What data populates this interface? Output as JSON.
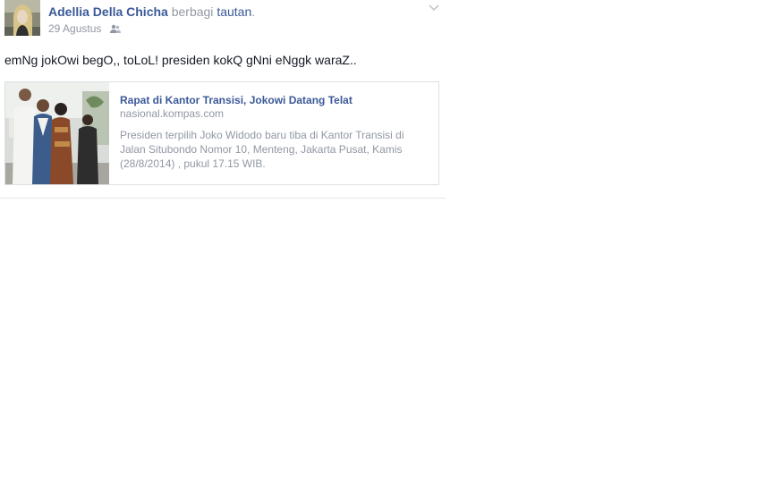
{
  "post": {
    "author": "Adellia Della Chicha",
    "verb": "berbagi",
    "object_link": "tautan",
    "punctuation": ".",
    "date": "29 Agustus",
    "audience_icon": "friends-icon",
    "message": "emNg jokOwi begO,, toLoL! presiden kokQ gNni eNggk waraZ..",
    "attachment": {
      "title": "Rapat di Kantor Transisi, Jokowi Datang Telat",
      "domain": "nasional.kompas.com",
      "description": "Presiden terpilih Joko Widodo baru tiba di Kantor Transisi di Jalan Situbondo Nomor 10, Menteng, Jakarta Pusat, Kamis (28/8/2014) , pukul 17.15 WIB."
    }
  },
  "colors": {
    "link_blue": "#3b5998",
    "meta_gray": "#9197a3",
    "text": "#141823",
    "border": "#dddfe2"
  }
}
